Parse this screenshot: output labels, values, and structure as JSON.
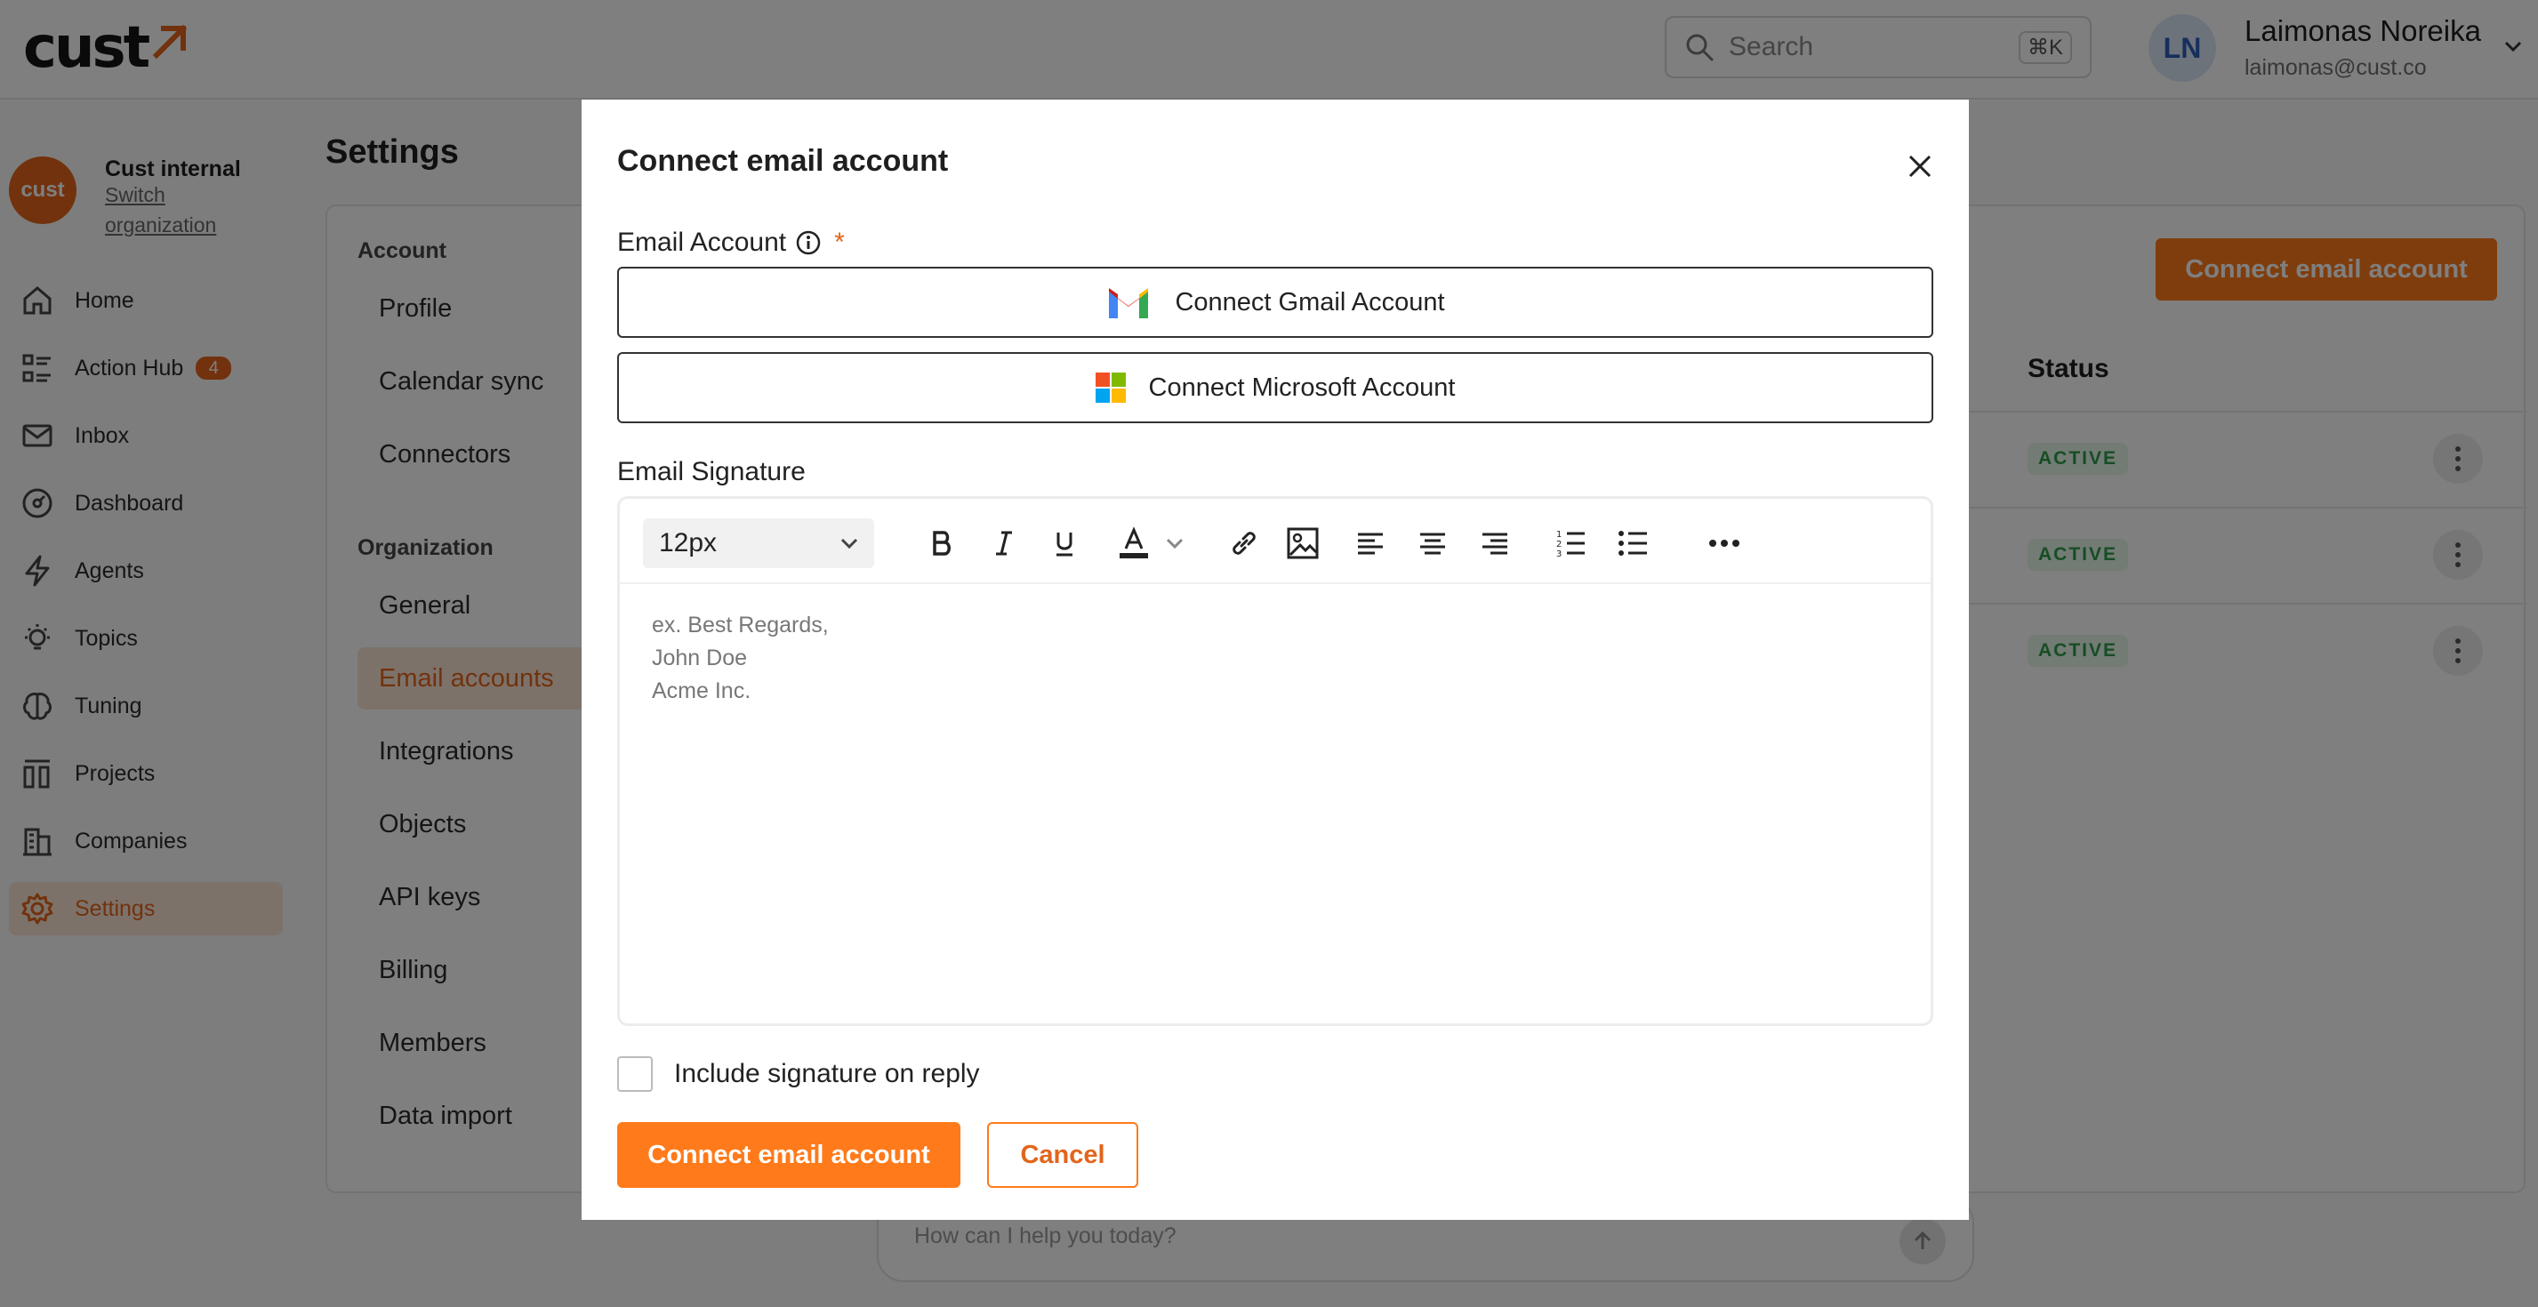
{
  "app": {
    "logo_text": "cust",
    "search": {
      "placeholder": "Search",
      "shortcut": "⌘K"
    },
    "user": {
      "initials": "LN",
      "name": "Laimonas Noreika",
      "email": "laimonas@cust.co"
    },
    "org": {
      "logo_text": "cust",
      "name": "Cust internal",
      "switch_label": "Switch organization"
    },
    "accent": "#ff7a1a"
  },
  "nav": {
    "items": [
      {
        "label": "Home",
        "icon": "home-icon"
      },
      {
        "label": "Action Hub",
        "icon": "list-icon",
        "badge": "4"
      },
      {
        "label": "Inbox",
        "icon": "mail-icon"
      },
      {
        "label": "Dashboard",
        "icon": "gauge-icon"
      },
      {
        "label": "Agents",
        "icon": "lightning-icon"
      },
      {
        "label": "Topics",
        "icon": "bulb-icon"
      },
      {
        "label": "Tuning",
        "icon": "brain-icon"
      },
      {
        "label": "Projects",
        "icon": "projects-icon"
      },
      {
        "label": "Companies",
        "icon": "building-icon"
      },
      {
        "label": "Settings",
        "icon": "gear-icon",
        "active": true
      }
    ]
  },
  "settings": {
    "title": "Settings",
    "account_section": "Account",
    "account_items": [
      "Profile",
      "Calendar sync",
      "Connectors"
    ],
    "org_section": "Organization",
    "org_items": [
      "General",
      "Email accounts",
      "Integrations",
      "Objects",
      "API keys",
      "Billing",
      "Members",
      "Data import"
    ],
    "active_item": "Email accounts",
    "connect_button": "Connect email account",
    "status_header": "Status",
    "rows": [
      {
        "status": "ACTIVE"
      },
      {
        "status": "ACTIVE"
      },
      {
        "status": "ACTIVE"
      }
    ]
  },
  "chat": {
    "placeholder": "How can I help you today?"
  },
  "modal": {
    "title": "Connect email account",
    "email_account_label": "Email Account",
    "required_mark": "*",
    "gmail_button": "Connect Gmail Account",
    "microsoft_button": "Connect Microsoft Account",
    "signature_label": "Email Signature",
    "font_size": "12px",
    "signature_placeholder": [
      "ex. Best Regards,",
      "John Doe",
      "Acme Inc."
    ],
    "include_signature_label": "Include signature on reply",
    "include_signature_checked": false,
    "submit_button": "Connect email account",
    "cancel_button": "Cancel"
  }
}
